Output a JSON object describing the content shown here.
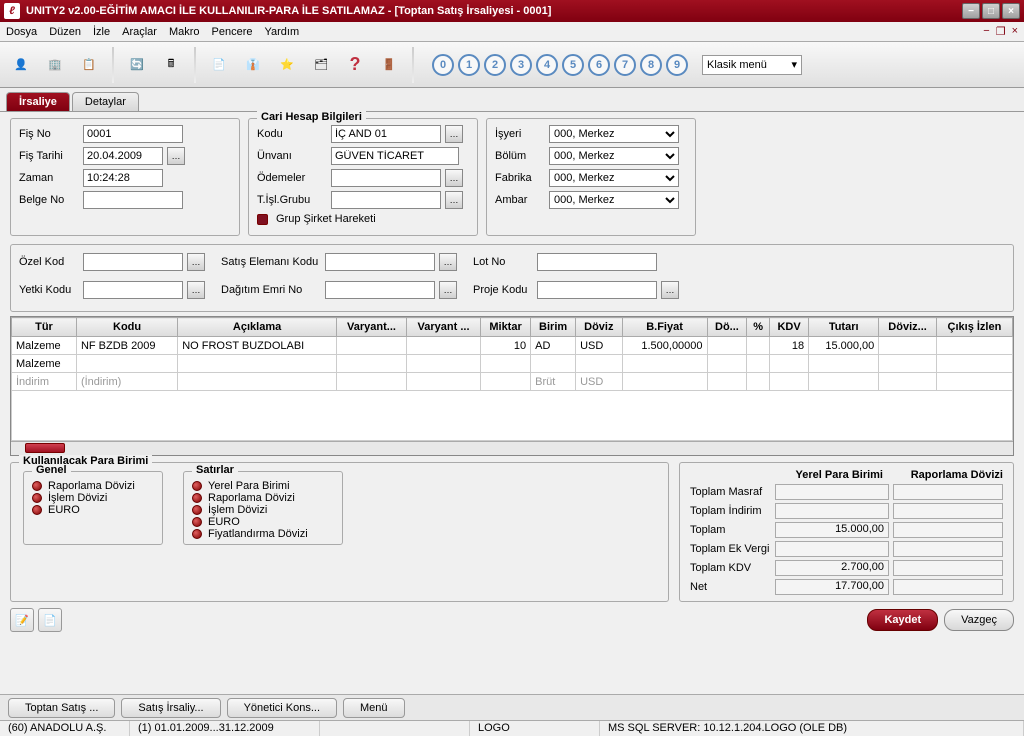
{
  "title": "UNITY2 v2.00-EĞİTİM AMACI İLE KULLANILIR-PARA İLE SATILAMAZ - [Toptan Satış İrsaliyesi - 0001]",
  "menubar": [
    "Dosya",
    "Düzen",
    "İzle",
    "Araçlar",
    "Makro",
    "Pencere",
    "Yardım"
  ],
  "quickmenu": "Klasik menü",
  "tabs": {
    "active": "İrsaliye",
    "other": "Detaylar"
  },
  "left": {
    "fis_no_label": "Fiş No",
    "fis_no": "0001",
    "fis_tarihi_label": "Fiş Tarihi",
    "fis_tarihi": "20.04.2009",
    "zaman_label": "Zaman",
    "zaman": "10:24:28",
    "belge_no_label": "Belge No",
    "belge_no": ""
  },
  "cari": {
    "title": "Cari Hesap Bilgileri",
    "kodu_label": "Kodu",
    "kodu": "İÇ AND 01",
    "unvani_label": "Ünvanı",
    "unvani": "GÜVEN TİCARET",
    "odemeler_label": "Ödemeler",
    "odemeler": "",
    "tislgrubu_label": "T.İşl.Grubu",
    "tislgrubu": "",
    "grup": "Grup Şirket Hareketi"
  },
  "right": {
    "isyeri_label": "İşyeri",
    "isyeri": "000, Merkez",
    "bolum_label": "Bölüm",
    "bolum": "000, Merkez",
    "fabrika_label": "Fabrika",
    "fabrika": "000, Merkez",
    "ambar_label": "Ambar",
    "ambar": "000, Merkez"
  },
  "filters": {
    "ozel_kod_label": "Özel Kod",
    "yetki_kodu_label": "Yetki Kodu",
    "satis_eleman_label": "Satış Elemanı Kodu",
    "dagitim_emri_label": "Dağıtım Emri No",
    "lot_no_label": "Lot No",
    "proje_kodu_label": "Proje Kodu"
  },
  "grid": {
    "headers": [
      "Tür",
      "Kodu",
      "Açıklama",
      "Varyant...",
      "Varyant ...",
      "Miktar",
      "Birim",
      "Döviz",
      "B.Fiyat",
      "Dö...",
      "%",
      "KDV",
      "Tutarı",
      "Döviz...",
      "Çıkış İzlen"
    ],
    "rows": [
      {
        "tur": "Malzeme",
        "kodu": "NF BZDB 2009",
        "aciklama": "NO FROST BUZDOLABI",
        "v1": "",
        "v2": "",
        "miktar": "10",
        "birim": "AD",
        "doviz": "USD",
        "bfiyat": "1.500,00000",
        "do": "",
        "pct": "",
        "kdv": "18",
        "tutari": "15.000,00",
        "dov2": "",
        "cikis": ""
      },
      {
        "tur": "Malzeme",
        "kodu": "",
        "aciklama": "",
        "v1": "",
        "v2": "",
        "miktar": "",
        "birim": "",
        "doviz": "",
        "bfiyat": "",
        "do": "",
        "pct": "",
        "kdv": "",
        "tutari": "",
        "dov2": "",
        "cikis": ""
      },
      {
        "tur": "İndirim",
        "kodu": "(İndirim)",
        "aciklama": "",
        "v1": "",
        "v2": "",
        "miktar": "",
        "birim": "Brüt",
        "doviz": "USD",
        "bfiyat": "",
        "do": "",
        "pct": "",
        "kdv": "",
        "tutari": "",
        "dov2": "",
        "cikis": ""
      }
    ]
  },
  "currency": {
    "title": "Kullanılacak Para Birimi",
    "genel_title": "Genel",
    "genel": [
      "Raporlama Dövizi",
      "İşlem Dövizi",
      "EURO"
    ],
    "satirlar_title": "Satırlar",
    "satirlar": [
      "Yerel Para Birimi",
      "Raporlama Dövizi",
      "İşlem Dövizi",
      "EURO",
      "Fiyatlandırma Dövizi"
    ]
  },
  "totals": {
    "h1": "Yerel Para Birimi",
    "h2": "Raporlama Dövizi",
    "rows": [
      {
        "label": "Toplam Masraf",
        "v": ""
      },
      {
        "label": "Toplam İndirim",
        "v": ""
      },
      {
        "label": "Toplam",
        "v": "15.000,00"
      },
      {
        "label": "Toplam Ek Vergi",
        "v": ""
      },
      {
        "label": "Toplam KDV",
        "v": "2.700,00"
      },
      {
        "label": "Net",
        "v": "17.700,00"
      }
    ]
  },
  "buttons": {
    "save": "Kaydet",
    "cancel": "Vazgeç"
  },
  "taskbar": [
    "Toptan Satış ...",
    "Satış İrsaliy...",
    "Yönetici Kons...",
    "Menü"
  ],
  "status": {
    "company": "(60) ANADOLU A.Ş.",
    "period": "(1) 01.01.2009...31.12.2009",
    "logo": "LOGO",
    "db": "MS SQL SERVER: 10.12.1.204.LOGO (OLE DB)"
  }
}
